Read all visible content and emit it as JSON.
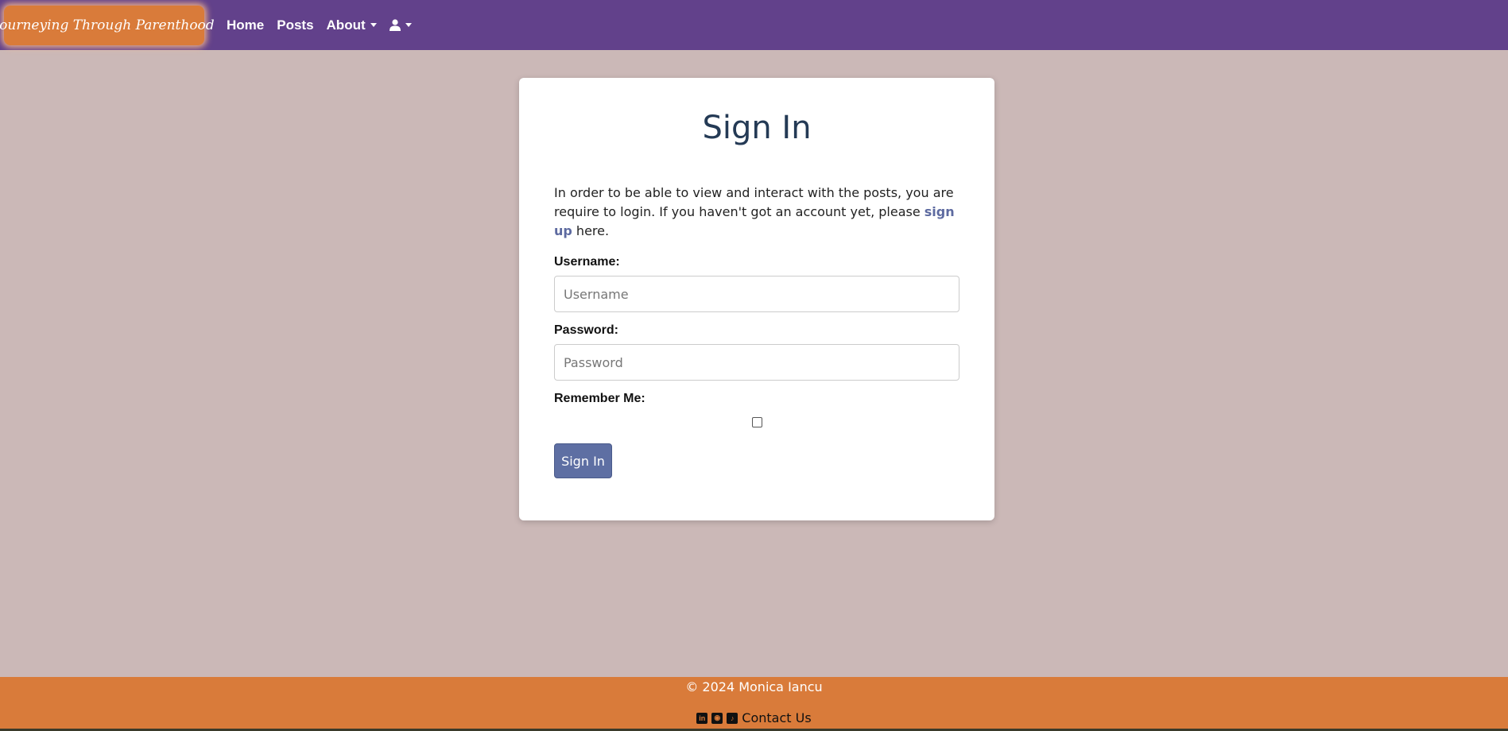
{
  "navbar": {
    "brand": "Journeying Through Parenthood",
    "links": [
      "Home",
      "Posts",
      "About"
    ]
  },
  "signin": {
    "title": "Sign In",
    "intro_before": "In order to be able to view and interact with the posts, you are require to login. If you haven't got an account yet, please ",
    "intro_link": "sign up",
    "intro_after": " here.",
    "username_label": "Username:",
    "username_placeholder": "Username",
    "password_label": "Password:",
    "password_placeholder": "Password",
    "remember_label": "Remember Me:",
    "button_label": "Sign In"
  },
  "footer": {
    "copyright": "© 2024 Monica Iancu",
    "contact": "Contact Us"
  },
  "icons": {
    "user": "user-icon",
    "social": [
      "linkedin-icon",
      "github-icon",
      "tiktok-icon"
    ]
  },
  "colors": {
    "navbar": "#62418b",
    "brand": "#d97b3a",
    "background": "#cbb8b7",
    "button": "#5e6fa3",
    "footer": "#d97b3a"
  }
}
